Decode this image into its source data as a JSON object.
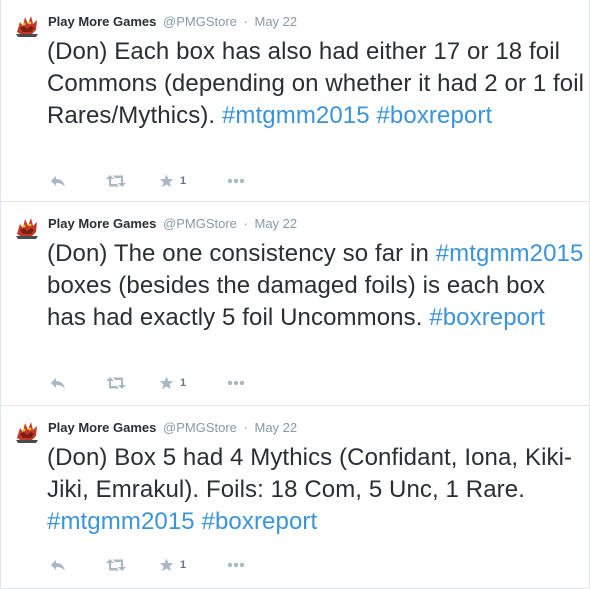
{
  "colors": {
    "link": "#3b94d9",
    "text": "#292f33",
    "muted": "#8899a6",
    "icon": "#aab8c2",
    "divider": "#e1e8ed",
    "avatar_red": "#c0392b"
  },
  "icons": {
    "reply": "reply-icon",
    "retweet": "retweet-icon",
    "favorite": "star-icon",
    "more": "more-icon",
    "avatar": "dragon-logo-icon"
  },
  "tweets": [
    {
      "author_name": "Play More Games",
      "handle": "@PMGStore",
      "separator": "·",
      "date": "May 22",
      "text_parts": {
        "t0": "(Don) Each box has also had either 17 or 18 foil Commons (depending on whether it had 2 or 1 foil Rares/Mythics). ",
        "l0": "#mtgmm2015",
        "t1": " ",
        "l1": "#boxreport",
        "t2": ""
      },
      "favorite_count": "1"
    },
    {
      "author_name": "Play More Games",
      "handle": "@PMGStore",
      "separator": "·",
      "date": "May 22",
      "text_parts": {
        "t0": "(Don) The one consistency so far in ",
        "l0": "#mtgmm2015",
        "t1": " boxes (besides the damaged foils) is each box has had exactly 5 foil Uncommons. ",
        "l1": "#boxreport",
        "t2": ""
      },
      "favorite_count": "1"
    },
    {
      "author_name": "Play More Games",
      "handle": "@PMGStore",
      "separator": "·",
      "date": "May 22",
      "text_parts": {
        "t0": "(Don) Box 5 had 4 Mythics (Confidant, Iona, Kiki-Jiki, Emrakul). Foils: 18 Com, 5 Unc, 1 Rare. ",
        "l0": "#mtgmm2015",
        "t1": " ",
        "l1": "#boxreport",
        "t2": ""
      },
      "favorite_count": "1"
    }
  ]
}
